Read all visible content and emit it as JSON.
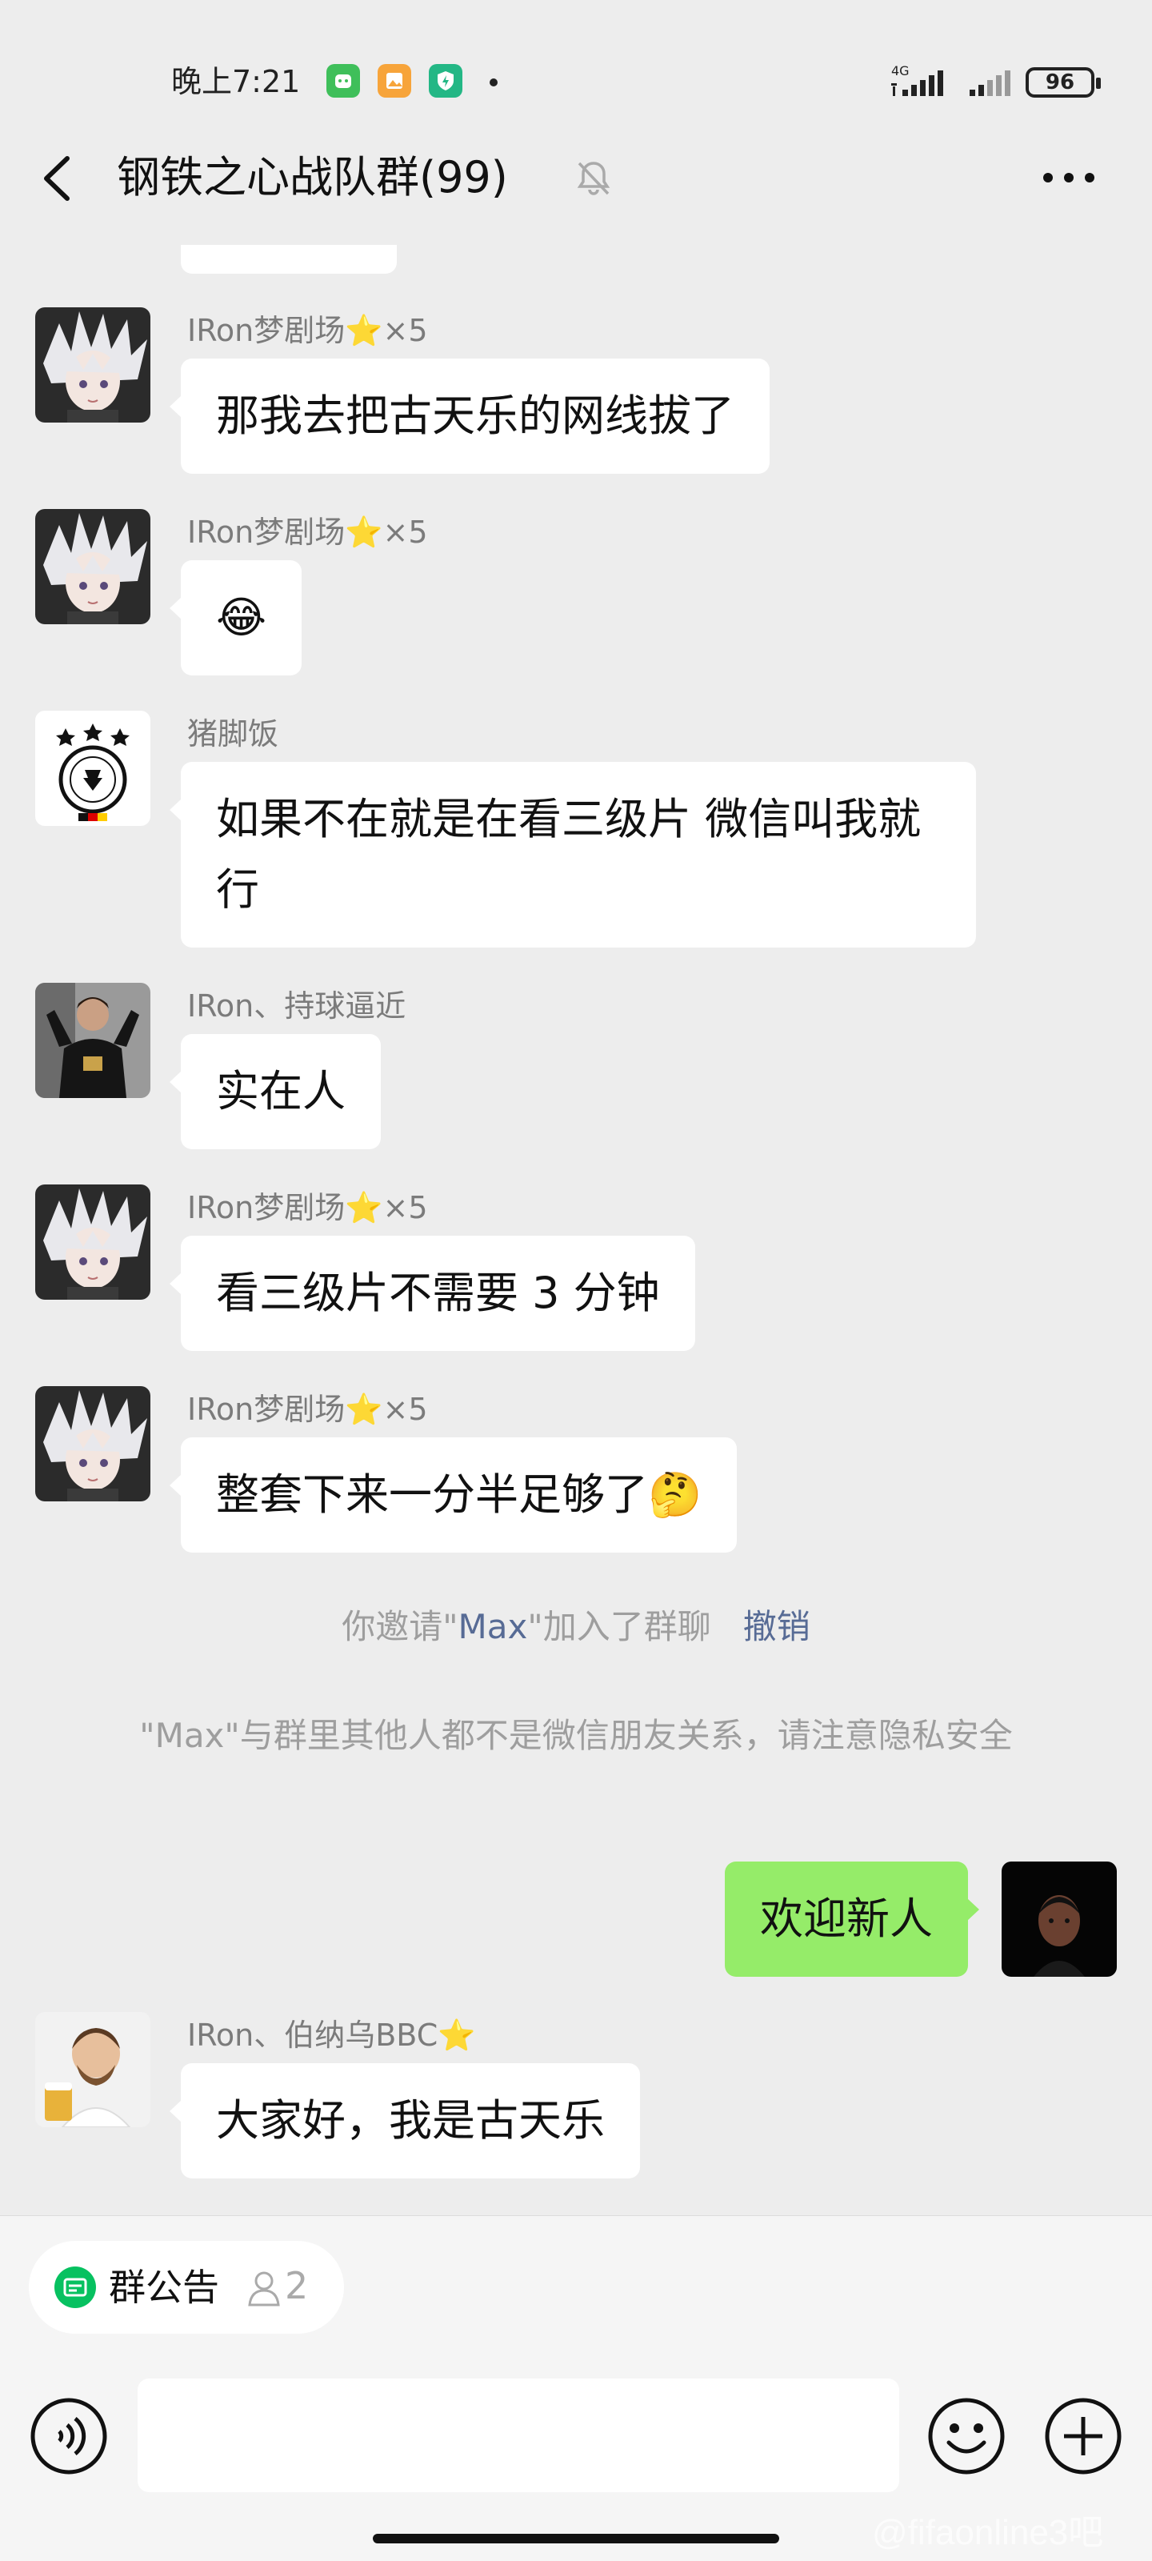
{
  "status_bar": {
    "time": "晚上7:21",
    "network": "4G",
    "battery": "96"
  },
  "nav": {
    "title": "钢铁之心战队群(99)"
  },
  "messages": [
    {
      "nickname": "IRon梦剧场⭐×5",
      "text": "那我去把古天乐的网线拔了"
    },
    {
      "nickname": "IRon梦剧场⭐×5",
      "text": "😂"
    },
    {
      "nickname": "猪脚饭",
      "text": "如果不在就是在看三级片 微信叫我就行"
    },
    {
      "nickname": "IRon、持球逼近",
      "text": "实在人"
    },
    {
      "nickname": "IRon梦剧场⭐×5",
      "text": "看三级片不需要 3 分钟"
    },
    {
      "nickname": "IRon梦剧场⭐×5",
      "text": "整套下来一分半足够了🤔"
    }
  ],
  "system": {
    "invite_prefix": "你邀请\"",
    "invite_name": "Max",
    "invite_suffix": "\"加入了群聊",
    "revoke": "撤销",
    "privacy_notice": "\"Max\"与群里其他人都不是微信朋友关系，请注意隐私安全"
  },
  "my_message": {
    "text": "欢迎新人"
  },
  "last_message": {
    "nickname": "IRon、伯纳乌BBC⭐",
    "text": "大家好，我是古天乐"
  },
  "notice_chip": {
    "label": "群公告",
    "count": "2"
  },
  "watermark": "@fifaonline3吧",
  "colors": {
    "background": "#ededed",
    "my_bubble": "#95ec69",
    "link": "#576b95"
  }
}
